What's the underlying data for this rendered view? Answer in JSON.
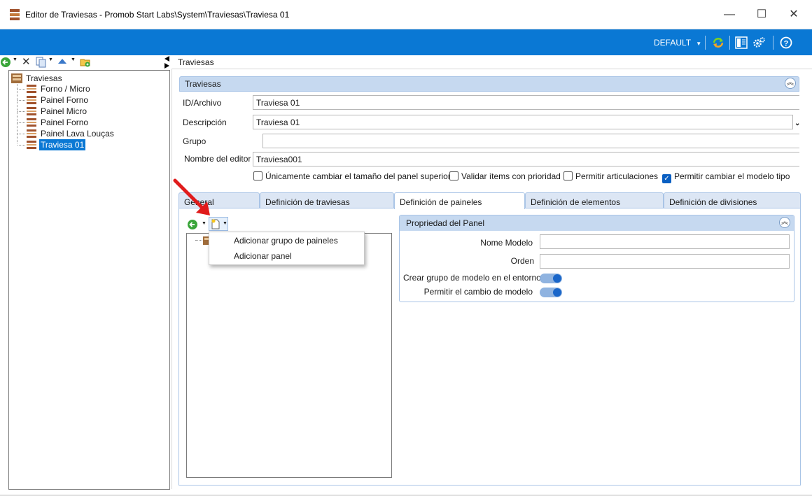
{
  "window": {
    "title": "Editor de Traviesas - Promob Start Labs\\System\\Traviesas\\Traviesa 01",
    "minimize_glyph": "—",
    "maximize_glyph": "☐",
    "close_glyph": "✕"
  },
  "ribbon": {
    "profile_dropdown": "DEFAULT",
    "accent_color": "#0a78d4"
  },
  "left_tree": {
    "root": "Traviesas",
    "items": [
      {
        "label": "Forno / Micro"
      },
      {
        "label": "Painel Forno"
      },
      {
        "label": "Painel Micro"
      },
      {
        "label": "Painel Forno"
      },
      {
        "label": "Painel Lava Louças"
      },
      {
        "label": "Traviesa 01",
        "selected": true
      }
    ]
  },
  "right": {
    "title": "Traviesas",
    "group": {
      "title": "Traviesas",
      "fields": {
        "id_label": "ID/Archivo",
        "id_value": "Traviesa 01",
        "desc_label": "Descripción",
        "desc_value": "Traviesa 01",
        "grupo_label": "Grupo",
        "grupo_value": "",
        "editor_label": "Nombre del editor",
        "editor_value": "Traviesa001"
      },
      "checkboxes": [
        {
          "label": "Únicamente cambiar el tamaño del panel superior",
          "checked": false
        },
        {
          "label": "Validar ítems con prioridad",
          "checked": false
        },
        {
          "label": "Permitir articulaciones",
          "checked": false
        },
        {
          "label": "Permitir cambiar el modelo tipo",
          "checked": true
        }
      ]
    },
    "tabs": [
      {
        "label": "General"
      },
      {
        "label": "Definición de traviesas"
      },
      {
        "label": "Definición de paineles",
        "active": true
      },
      {
        "label": "Definición de elementos"
      },
      {
        "label": "Definición de divisiones"
      }
    ],
    "properties": {
      "title": "Propriedad del Panel",
      "nome_modelo_label": "Nome Modelo",
      "orden_label": "Orden",
      "crear_grupo_label": "Crear grupo de modelo en el entorno",
      "permitir_cambio_label": "Permitir el cambio de modelo"
    },
    "context_menu": {
      "items": [
        "Adicionar grupo de paineles",
        "Adicionar panel"
      ]
    }
  }
}
